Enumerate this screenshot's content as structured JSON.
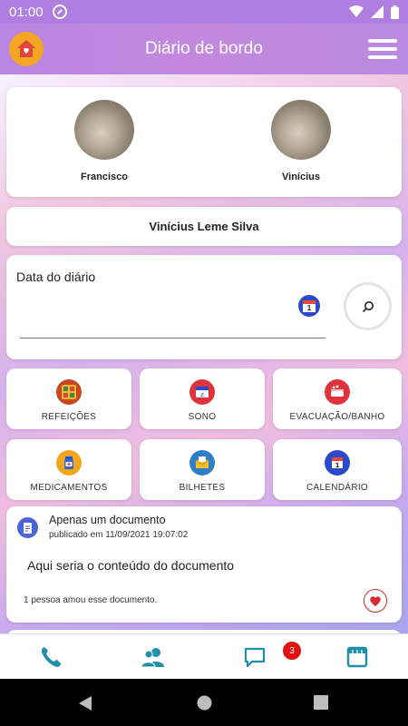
{
  "status": {
    "time": "01:00"
  },
  "header": {
    "title": "Diário de bordo"
  },
  "children": [
    {
      "name": "Francisco"
    },
    {
      "name": "Vinícius"
    }
  ],
  "student": {
    "name": "Vinícius Leme Silva"
  },
  "date": {
    "label": "Data do diário",
    "calendar_day": "1"
  },
  "tiles": [
    {
      "label": "REFEIÇÕES",
      "icon": "meal-icon"
    },
    {
      "label": "SONO",
      "icon": "sleep-icon"
    },
    {
      "label": "EVACUAÇÃO/BANHO",
      "icon": "bath-icon"
    },
    {
      "label": "MEDICAMENTOS",
      "icon": "medicine-icon"
    },
    {
      "label": "BILHETES",
      "icon": "note-icon"
    },
    {
      "label": "CALENDÁRIO",
      "icon": "calendar-icon"
    }
  ],
  "document": {
    "title": "Apenas um documento",
    "published": "publicado em 11/09/2021 19:07:02",
    "body": "Aqui seria o conteúdo do documento",
    "likes": "1 pessoa amou esse documento."
  },
  "bottom_nav": {
    "badge": "3"
  },
  "colors": {
    "accent": "#b986e3",
    "icon_teal": "#1f8fa8",
    "badge": "#e01010"
  }
}
